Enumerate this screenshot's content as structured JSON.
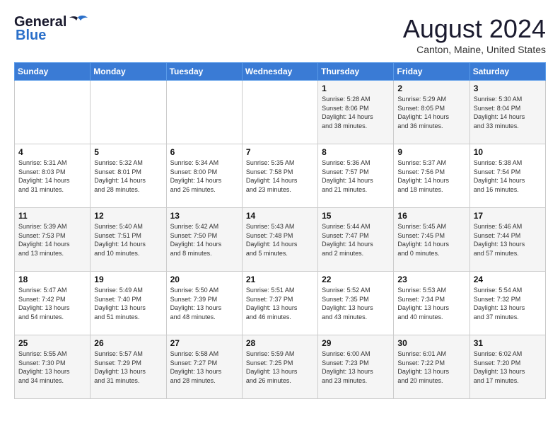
{
  "header": {
    "logo_general": "General",
    "logo_blue": "Blue",
    "month_year": "August 2024",
    "location": "Canton, Maine, United States"
  },
  "weekdays": [
    "Sunday",
    "Monday",
    "Tuesday",
    "Wednesday",
    "Thursday",
    "Friday",
    "Saturday"
  ],
  "weeks": [
    [
      {
        "day": "",
        "info": ""
      },
      {
        "day": "",
        "info": ""
      },
      {
        "day": "",
        "info": ""
      },
      {
        "day": "",
        "info": ""
      },
      {
        "day": "1",
        "info": "Sunrise: 5:28 AM\nSunset: 8:06 PM\nDaylight: 14 hours\nand 38 minutes."
      },
      {
        "day": "2",
        "info": "Sunrise: 5:29 AM\nSunset: 8:05 PM\nDaylight: 14 hours\nand 36 minutes."
      },
      {
        "day": "3",
        "info": "Sunrise: 5:30 AM\nSunset: 8:04 PM\nDaylight: 14 hours\nand 33 minutes."
      }
    ],
    [
      {
        "day": "4",
        "info": "Sunrise: 5:31 AM\nSunset: 8:03 PM\nDaylight: 14 hours\nand 31 minutes."
      },
      {
        "day": "5",
        "info": "Sunrise: 5:32 AM\nSunset: 8:01 PM\nDaylight: 14 hours\nand 28 minutes."
      },
      {
        "day": "6",
        "info": "Sunrise: 5:34 AM\nSunset: 8:00 PM\nDaylight: 14 hours\nand 26 minutes."
      },
      {
        "day": "7",
        "info": "Sunrise: 5:35 AM\nSunset: 7:58 PM\nDaylight: 14 hours\nand 23 minutes."
      },
      {
        "day": "8",
        "info": "Sunrise: 5:36 AM\nSunset: 7:57 PM\nDaylight: 14 hours\nand 21 minutes."
      },
      {
        "day": "9",
        "info": "Sunrise: 5:37 AM\nSunset: 7:56 PM\nDaylight: 14 hours\nand 18 minutes."
      },
      {
        "day": "10",
        "info": "Sunrise: 5:38 AM\nSunset: 7:54 PM\nDaylight: 14 hours\nand 16 minutes."
      }
    ],
    [
      {
        "day": "11",
        "info": "Sunrise: 5:39 AM\nSunset: 7:53 PM\nDaylight: 14 hours\nand 13 minutes."
      },
      {
        "day": "12",
        "info": "Sunrise: 5:40 AM\nSunset: 7:51 PM\nDaylight: 14 hours\nand 10 minutes."
      },
      {
        "day": "13",
        "info": "Sunrise: 5:42 AM\nSunset: 7:50 PM\nDaylight: 14 hours\nand 8 minutes."
      },
      {
        "day": "14",
        "info": "Sunrise: 5:43 AM\nSunset: 7:48 PM\nDaylight: 14 hours\nand 5 minutes."
      },
      {
        "day": "15",
        "info": "Sunrise: 5:44 AM\nSunset: 7:47 PM\nDaylight: 14 hours\nand 2 minutes."
      },
      {
        "day": "16",
        "info": "Sunrise: 5:45 AM\nSunset: 7:45 PM\nDaylight: 14 hours\nand 0 minutes."
      },
      {
        "day": "17",
        "info": "Sunrise: 5:46 AM\nSunset: 7:44 PM\nDaylight: 13 hours\nand 57 minutes."
      }
    ],
    [
      {
        "day": "18",
        "info": "Sunrise: 5:47 AM\nSunset: 7:42 PM\nDaylight: 13 hours\nand 54 minutes."
      },
      {
        "day": "19",
        "info": "Sunrise: 5:49 AM\nSunset: 7:40 PM\nDaylight: 13 hours\nand 51 minutes."
      },
      {
        "day": "20",
        "info": "Sunrise: 5:50 AM\nSunset: 7:39 PM\nDaylight: 13 hours\nand 48 minutes."
      },
      {
        "day": "21",
        "info": "Sunrise: 5:51 AM\nSunset: 7:37 PM\nDaylight: 13 hours\nand 46 minutes."
      },
      {
        "day": "22",
        "info": "Sunrise: 5:52 AM\nSunset: 7:35 PM\nDaylight: 13 hours\nand 43 minutes."
      },
      {
        "day": "23",
        "info": "Sunrise: 5:53 AM\nSunset: 7:34 PM\nDaylight: 13 hours\nand 40 minutes."
      },
      {
        "day": "24",
        "info": "Sunrise: 5:54 AM\nSunset: 7:32 PM\nDaylight: 13 hours\nand 37 minutes."
      }
    ],
    [
      {
        "day": "25",
        "info": "Sunrise: 5:55 AM\nSunset: 7:30 PM\nDaylight: 13 hours\nand 34 minutes."
      },
      {
        "day": "26",
        "info": "Sunrise: 5:57 AM\nSunset: 7:29 PM\nDaylight: 13 hours\nand 31 minutes."
      },
      {
        "day": "27",
        "info": "Sunrise: 5:58 AM\nSunset: 7:27 PM\nDaylight: 13 hours\nand 28 minutes."
      },
      {
        "day": "28",
        "info": "Sunrise: 5:59 AM\nSunset: 7:25 PM\nDaylight: 13 hours\nand 26 minutes."
      },
      {
        "day": "29",
        "info": "Sunrise: 6:00 AM\nSunset: 7:23 PM\nDaylight: 13 hours\nand 23 minutes."
      },
      {
        "day": "30",
        "info": "Sunrise: 6:01 AM\nSunset: 7:22 PM\nDaylight: 13 hours\nand 20 minutes."
      },
      {
        "day": "31",
        "info": "Sunrise: 6:02 AM\nSunset: 7:20 PM\nDaylight: 13 hours\nand 17 minutes."
      }
    ]
  ]
}
